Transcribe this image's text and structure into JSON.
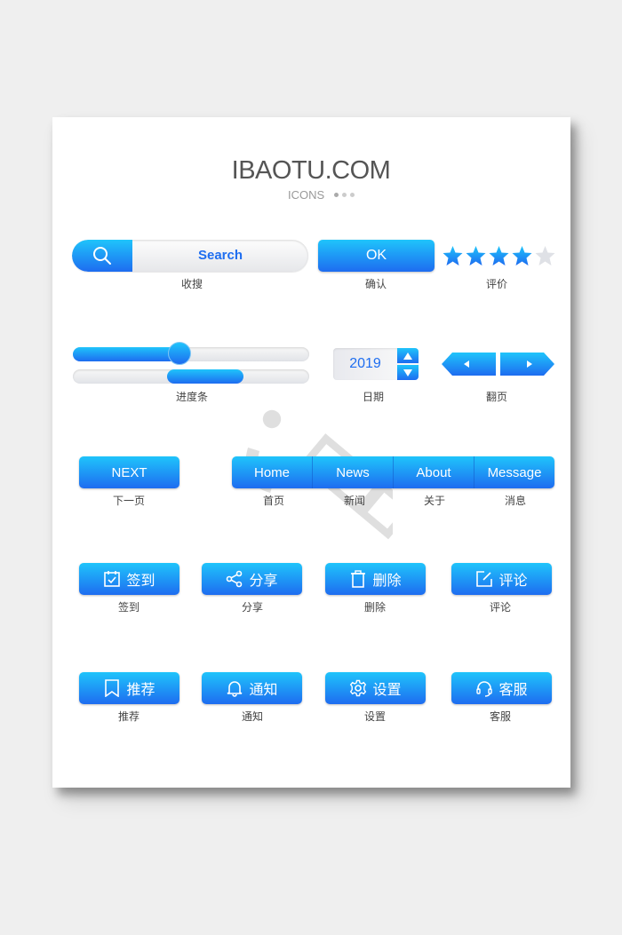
{
  "header": {
    "title": "IBAOTU.COM",
    "subtitle": "ICONS"
  },
  "row1": {
    "search": {
      "icon": "search-icon",
      "placeholder": "Search",
      "caption": "收搜"
    },
    "ok": {
      "label": "OK",
      "caption": "确认"
    },
    "rating": {
      "value": 4,
      "max": 5,
      "caption": "评价"
    }
  },
  "row2": {
    "progress": {
      "slider_value": 0.45,
      "bar_start": 0.4,
      "bar_end": 0.72,
      "caption": "进度条"
    },
    "date": {
      "value": "2019",
      "caption": "日期"
    },
    "pager": {
      "caption": "翻页"
    }
  },
  "row3": {
    "next": {
      "label": "NEXT",
      "caption": "下一页"
    },
    "nav": [
      {
        "label": "Home",
        "caption": "首页"
      },
      {
        "label": "News",
        "caption": "新闻"
      },
      {
        "label": "About",
        "caption": "关于"
      },
      {
        "label": "Message",
        "caption": "消息"
      }
    ]
  },
  "row4": [
    {
      "icon": "checkin-icon",
      "label": "签到",
      "caption": "签到"
    },
    {
      "icon": "share-icon",
      "label": "分享",
      "caption": "分享"
    },
    {
      "icon": "trash-icon",
      "label": "删除",
      "caption": "删除"
    },
    {
      "icon": "edit-icon",
      "label": "评论",
      "caption": "评论"
    }
  ],
  "row5": [
    {
      "icon": "bookmark-icon",
      "label": "推荐",
      "caption": "推荐"
    },
    {
      "icon": "bell-icon",
      "label": "通知",
      "caption": "通知"
    },
    {
      "icon": "gear-icon",
      "label": "设置",
      "caption": "设置"
    },
    {
      "icon": "headset-icon",
      "label": "客服",
      "caption": "客服"
    }
  ],
  "colors": {
    "accent_top": "#1fc4fb",
    "accent_bottom": "#1e6cf0",
    "text_blue": "#1f6ef0",
    "star_empty": "#dfe1e6"
  }
}
